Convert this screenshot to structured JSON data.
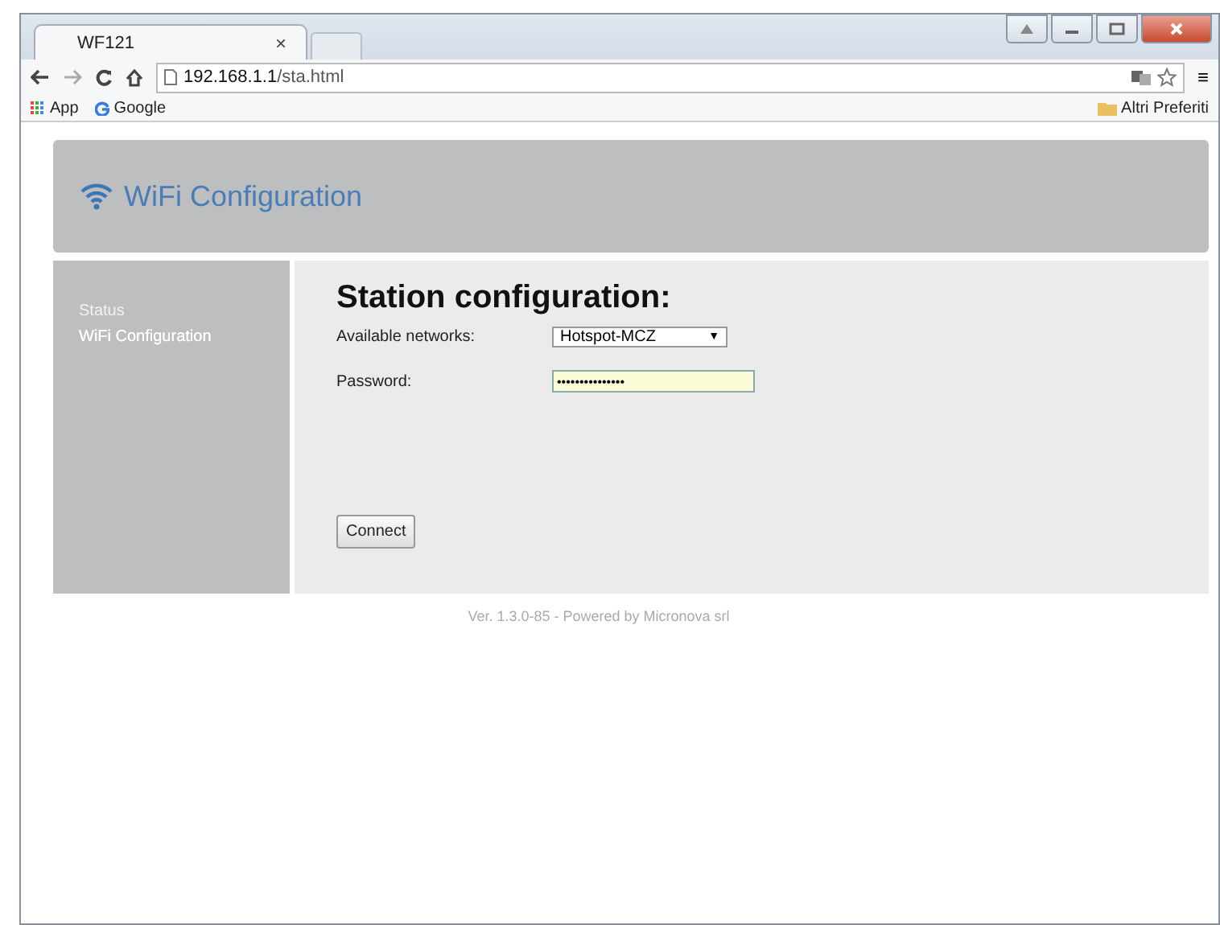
{
  "browser": {
    "tab": {
      "title": "WF121",
      "close": "×"
    },
    "address": {
      "host": "192.168.1.1",
      "path": "/sta.html"
    },
    "menu": "≡",
    "bookmarks": [
      {
        "label": "App",
        "kind": "apps"
      },
      {
        "label": "Google",
        "kind": "google"
      }
    ],
    "other_bookmarks": "Altri Preferiti"
  },
  "header": {
    "title": "WiFi Configuration"
  },
  "sidebar": {
    "items": [
      {
        "label": "Status",
        "selected": false
      },
      {
        "label": "WiFi Configuration",
        "selected": true
      }
    ]
  },
  "form": {
    "title": "Station configuration:",
    "networks": {
      "label": "Available networks:",
      "value": "Hotspot-MCZ",
      "arrow": "▼"
    },
    "password": {
      "label": "Password:",
      "value": "•••••••••••••••"
    },
    "button": "Connect"
  },
  "footer": {
    "text": "Ver. 1.3.0-85 - Powered by ",
    "link": "Micronova srl"
  }
}
